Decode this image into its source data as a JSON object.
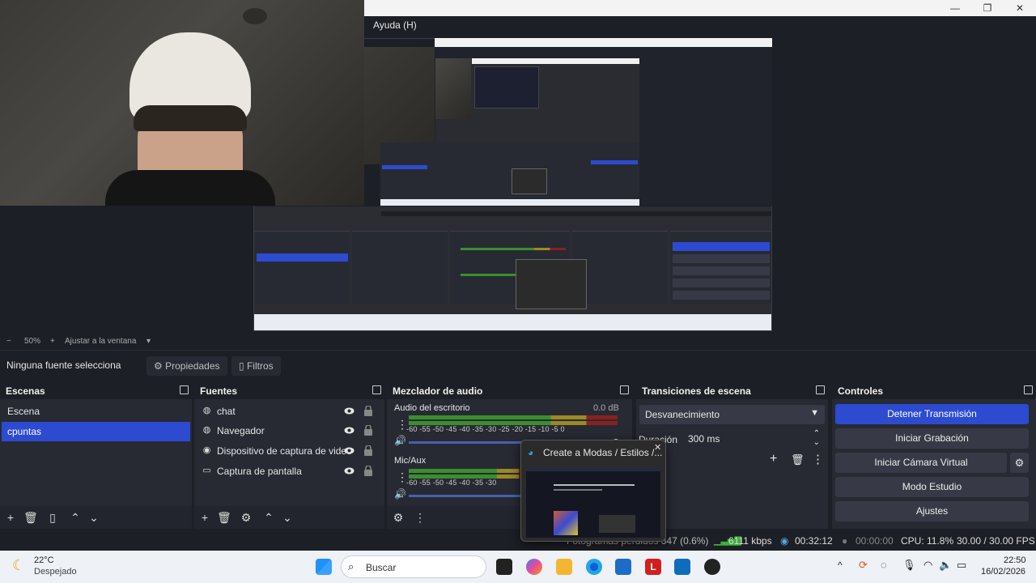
{
  "window": {
    "menu_help": "Ayuda (H)"
  },
  "zoom": {
    "minus": "−",
    "level": "50%",
    "plus": "+",
    "fit": "Ajustar a la ventana"
  },
  "toolbar": {
    "no_source": "Ninguna fuente selecciona",
    "properties": "Propiedades",
    "filters": "Filtros"
  },
  "scenes": {
    "title": "Escenas",
    "items": [
      {
        "label": "Escena",
        "selected": false
      },
      {
        "label": "cpuntas",
        "selected": true
      }
    ]
  },
  "sources": {
    "title": "Fuentes",
    "items": [
      {
        "label": "chat",
        "icon": "browser-icon"
      },
      {
        "label": "Navegador",
        "icon": "browser-icon"
      },
      {
        "label": "Dispositivo de captura de video",
        "icon": "camera-icon"
      },
      {
        "label": "Captura de pantalla",
        "icon": "monitor-icon"
      }
    ]
  },
  "mixer": {
    "title": "Mezclador de audio",
    "channels": [
      {
        "name": "Audio del escritorio",
        "db": "0.0 dB",
        "scale": "-60 -55 -50 -45 -40 -35 -30 -25 -20 -15 -10 -5 0"
      },
      {
        "name": "Mic/Aux",
        "db": "",
        "scale": "-60 -55 -50 -45 -40 -35 -30"
      }
    ]
  },
  "transitions": {
    "title": "Transiciones de escena",
    "selected": "Desvanecimiento",
    "duration_label": "Duración",
    "duration_value": "300 ms"
  },
  "controls": {
    "title": "Controles",
    "buttons": [
      "Detener Transmisión",
      "Iniciar Grabación",
      "Iniciar Cámara Virtual",
      "Modo Estudio",
      "Ajustes"
    ]
  },
  "popup": {
    "title": "Create a Modas / Estilos /..."
  },
  "status": {
    "dropped": "Fotogramas perdidos 347 (0.6%)",
    "bitrate": "6111 kbps",
    "live_time": "00:32:12",
    "rec_time": "00:00:00",
    "cpu": "CPU: 11.8%",
    "fps": "30.00 / 30.00 FPS"
  },
  "taskbar": {
    "temp": "22°C",
    "weather": "Despejado",
    "search": "Buscar",
    "time": "22:50",
    "date": "16/02/2026"
  },
  "colors": {
    "accent": "#2d4bd0",
    "panel": "#272a33",
    "bg": "#1d1f26"
  }
}
